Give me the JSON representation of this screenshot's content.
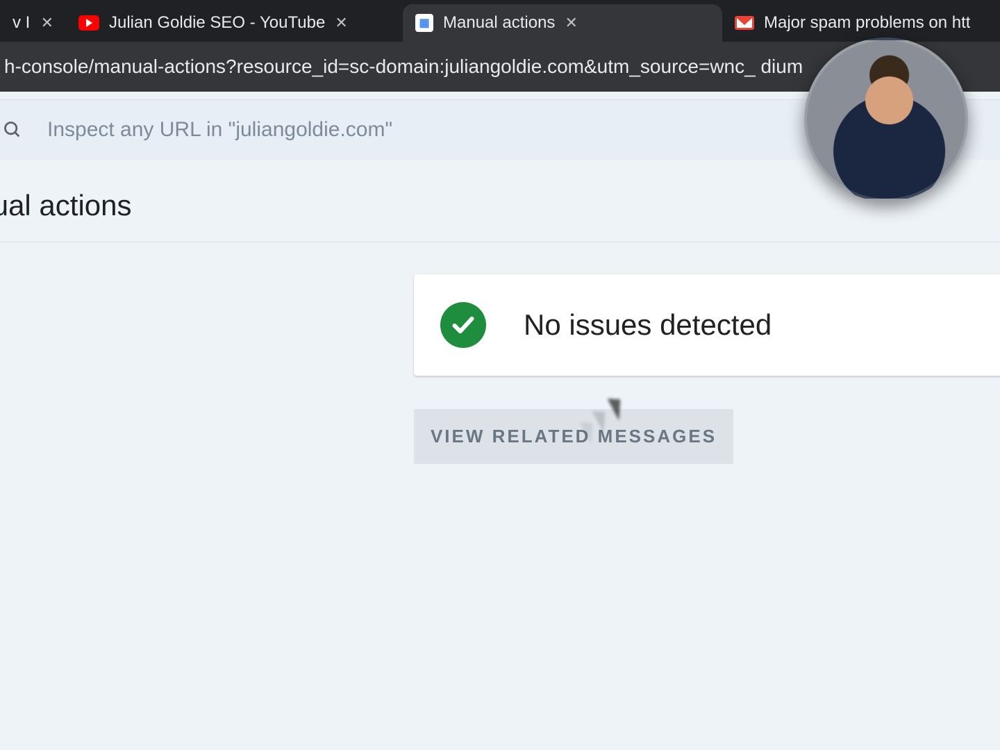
{
  "browser": {
    "tabs": [
      {
        "label": "v I (",
        "active": false,
        "closable": true
      },
      {
        "label": "Julian Goldie SEO - YouTube",
        "active": false,
        "closable": true
      },
      {
        "label": "Manual actions",
        "active": true,
        "closable": true
      },
      {
        "label": "Major spam problems on htt",
        "active": false,
        "closable": false
      }
    ],
    "url_fragment": "h-console/manual-actions?resource_id=sc-domain:juliangoldie.com&utm_source=wnc_           dium"
  },
  "inspect_placeholder": "Inspect any URL in \"juliangoldie.com\"",
  "page_title": "anual actions",
  "status": {
    "message": "No issues detected"
  },
  "related_button": "VIEW RELATED MESSAGES"
}
